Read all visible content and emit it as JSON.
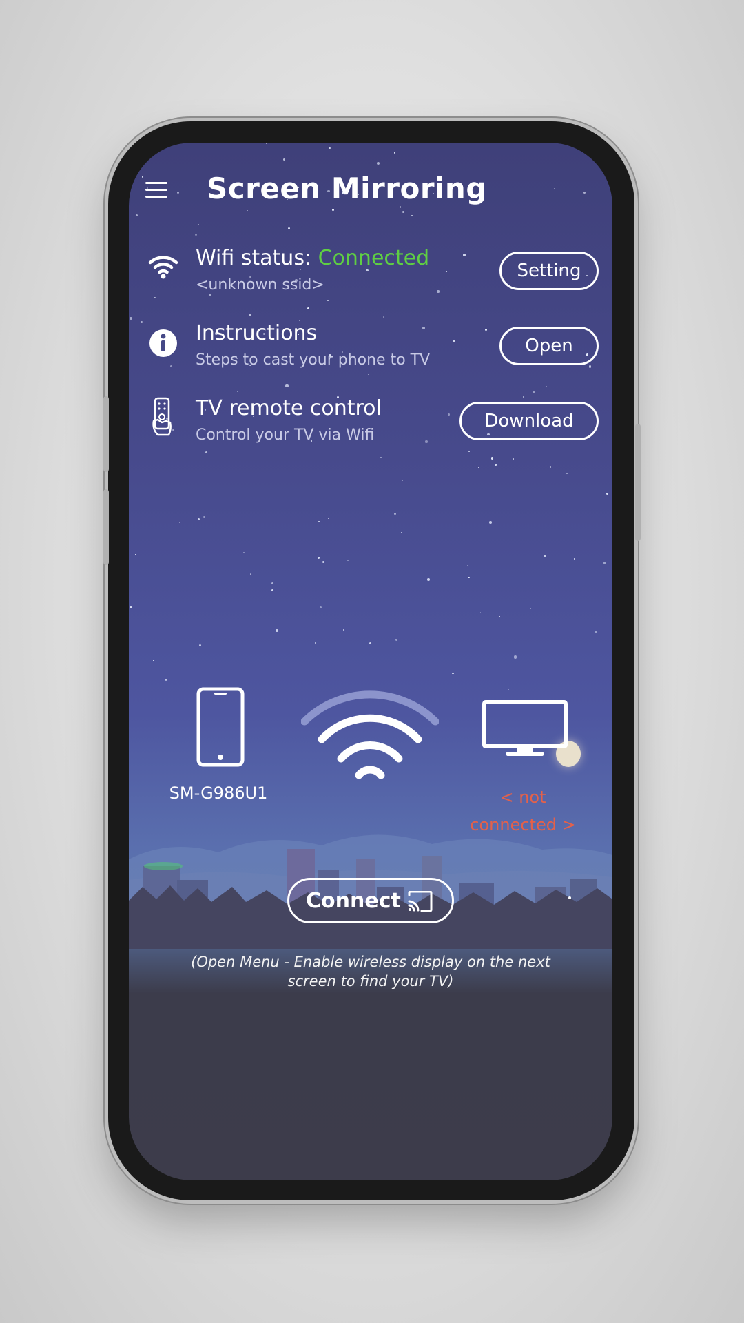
{
  "app": {
    "title": "Screen Mirroring"
  },
  "wifi": {
    "label": "Wifi status:",
    "status": "Connected",
    "ssid": "<unknown ssid>",
    "button": "Setting"
  },
  "instructions": {
    "title": "Instructions",
    "subtitle": "Steps to cast your phone to TV",
    "button": "Open"
  },
  "remote": {
    "title": "TV remote control",
    "subtitle": "Control your TV via Wifi",
    "button": "Download"
  },
  "devices": {
    "phone_name": "SM-G986U1",
    "tv_status": "< not connected >"
  },
  "connect": {
    "label": "Connect"
  },
  "hint": "(Open Menu - Enable wireless display on the next screen to find your TV)",
  "colors": {
    "connected": "#5fcf43",
    "not_connected": "#e4614a",
    "sky_top": "#3f4079",
    "bottom": "#3d3c4b"
  },
  "icons": [
    "menu-icon",
    "wifi-icon",
    "info-icon",
    "remote-icon",
    "smartphone-icon",
    "wifi-signal-icon",
    "tv-icon",
    "cast-icon"
  ]
}
